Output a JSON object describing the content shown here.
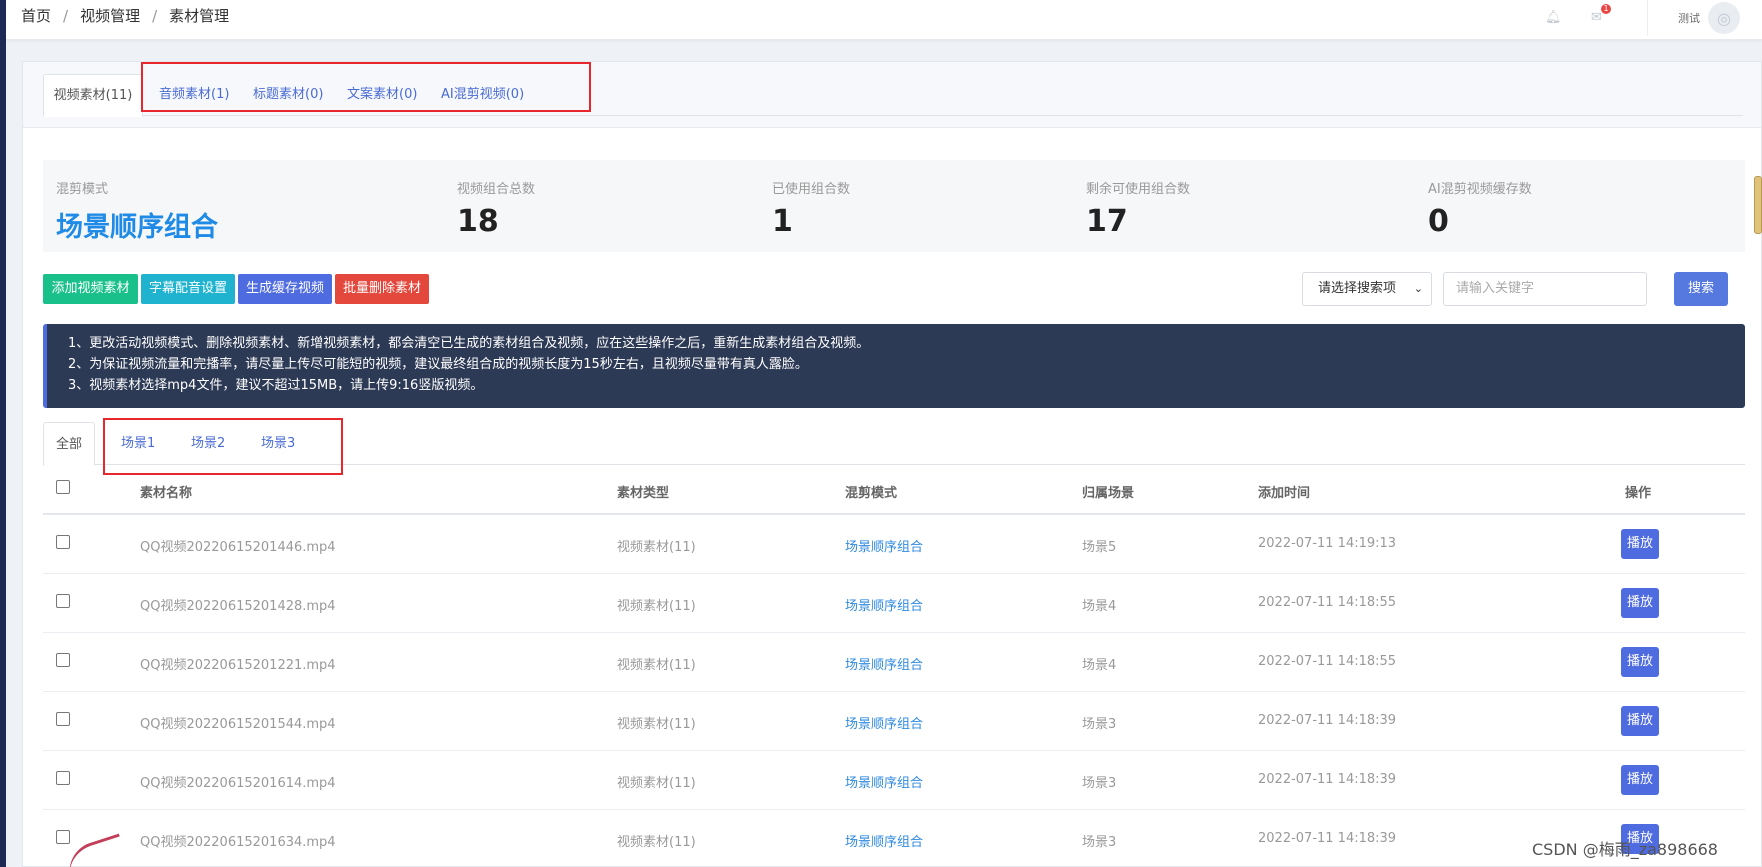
{
  "breadcrumb": [
    "首页",
    "视频管理",
    "素材管理"
  ],
  "header": {
    "notification_count": "1",
    "user_name": "测试"
  },
  "top_tabs": [
    {
      "label": "视频素材(11)",
      "active": true
    },
    {
      "label": "音频素材(1)",
      "active": false
    },
    {
      "label": "标题素材(0)",
      "active": false
    },
    {
      "label": "文案素材(0)",
      "active": false
    },
    {
      "label": "AI混剪视频(0)",
      "active": false
    }
  ],
  "stats": {
    "mode_label": "混剪模式",
    "mode_value": "场景顺序组合",
    "total_label": "视频组合总数",
    "total_value": "18",
    "used_label": "已使用组合数",
    "used_value": "1",
    "remaining_label": "剩余可使用组合数",
    "remaining_value": "17",
    "cache_label": "AI混剪视频缓存数",
    "cache_value": "0"
  },
  "actions": {
    "add": "添加视频素材",
    "subtitle": "字幕配音设置",
    "generate": "生成缓存视频",
    "batch_delete": "批量删除素材"
  },
  "search": {
    "select_value": "请选择搜索项",
    "placeholder": "请输入关键字",
    "button": "搜索"
  },
  "notice": [
    "1、更改活动视频模式、删除视频素材、新增视频素材，都会清空已生成的素材组合及视频，应在这些操作之后，重新生成素材组合及视频。",
    "2、为保证视频流量和完播率，请尽量上传尽可能短的视频，建议最终组合成的视频长度为15秒左右，且视频尽量带有真人露脸。",
    "3、视频素材选择mp4文件，建议不超过15MB，请上传9:16竖版视频。"
  ],
  "scene_tabs": [
    {
      "label": "全部",
      "active": true
    },
    {
      "label": "场景1",
      "active": false
    },
    {
      "label": "场景2",
      "active": false
    },
    {
      "label": "场景3",
      "active": false
    }
  ],
  "table": {
    "headers": [
      "素材名称",
      "素材类型",
      "混剪模式",
      "归属场景",
      "添加时间",
      "操作"
    ],
    "rows": [
      {
        "name": "QQ视频20220615201446.mp4",
        "type": "视频素材(11)",
        "mode": "场景顺序组合",
        "scene": "场景5",
        "time": "2022-07-11 14:19:13",
        "action": "播放"
      },
      {
        "name": "QQ视频20220615201428.mp4",
        "type": "视频素材(11)",
        "mode": "场景顺序组合",
        "scene": "场景4",
        "time": "2022-07-11 14:18:55",
        "action": "播放"
      },
      {
        "name": "QQ视频20220615201221.mp4",
        "type": "视频素材(11)",
        "mode": "场景顺序组合",
        "scene": "场景4",
        "time": "2022-07-11 14:18:55",
        "action": "播放"
      },
      {
        "name": "QQ视频20220615201544.mp4",
        "type": "视频素材(11)",
        "mode": "场景顺序组合",
        "scene": "场景3",
        "time": "2022-07-11 14:18:39",
        "action": "播放"
      },
      {
        "name": "QQ视频20220615201614.mp4",
        "type": "视频素材(11)",
        "mode": "场景顺序组合",
        "scene": "场景3",
        "time": "2022-07-11 14:18:39",
        "action": "播放"
      },
      {
        "name": "QQ视频20220615201634.mp4",
        "type": "视频素材(11)",
        "mode": "场景顺序组合",
        "scene": "场景3",
        "time": "2022-07-11 14:18:39",
        "action": "播放"
      }
    ]
  },
  "watermark": "CSDN @梅雨_za898668"
}
